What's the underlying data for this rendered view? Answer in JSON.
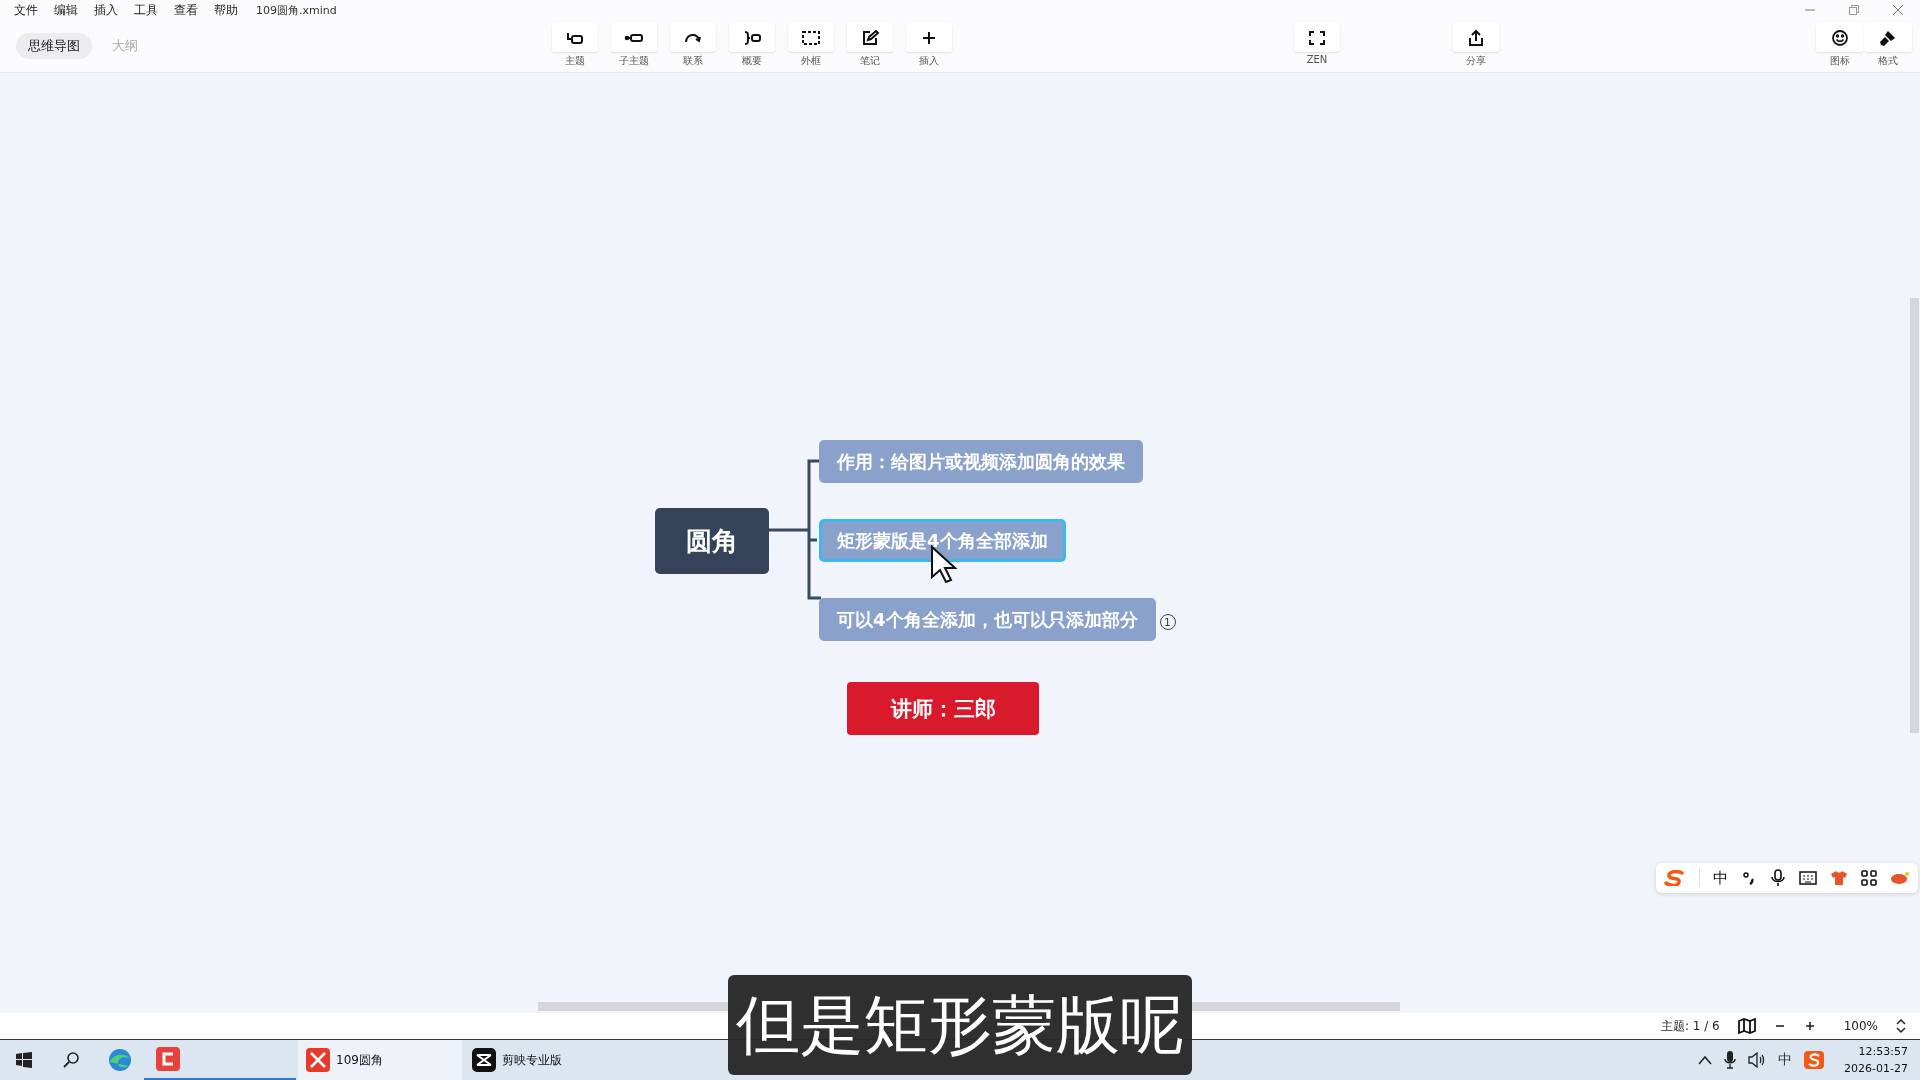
{
  "menu": [
    "文件",
    "编辑",
    "插入",
    "工具",
    "查看",
    "帮助"
  ],
  "file_name": "109圆角.xmind",
  "window_controls": [
    {
      "kind": "minimize"
    },
    {
      "kind": "restore"
    },
    {
      "kind": "close"
    }
  ],
  "view_tabs": [
    {
      "label": "思维导图",
      "selected": true
    },
    {
      "label": "大纲",
      "selected": false
    }
  ],
  "toolbar": [
    {
      "label": "主题",
      "kind": "topic"
    },
    {
      "label": "子主题",
      "kind": "subtopic"
    },
    {
      "label": "联系",
      "kind": "relation"
    },
    {
      "label": "概要",
      "kind": "summary"
    },
    {
      "label": "外框",
      "kind": "boundary"
    },
    {
      "label": "笔记",
      "kind": "note"
    },
    {
      "label": "插入",
      "kind": "insert"
    }
  ],
  "zen": {
    "label": "ZEN",
    "kind": "zen"
  },
  "share": {
    "label": "分享",
    "kind": "share"
  },
  "panel_tools": [
    {
      "label": "图标",
      "kind": "emoji"
    },
    {
      "label": "格式",
      "kind": "brush"
    }
  ],
  "mindmap": {
    "central": "圆角",
    "topics": [
      {
        "text": "作用：给图片或视频添加圆角的效果",
        "selected": false
      },
      {
        "text": "矩形蒙版是4个角全部添加",
        "selected": true
      },
      {
        "text": "可以4个角全添加，也可以只添加部分",
        "selected": false,
        "badge": "1"
      }
    ],
    "floating": "讲师：三郎"
  },
  "ime_bar": {
    "mode": "中"
  },
  "status_bar": {
    "topic_count": "主题: 1 / 6",
    "zoom": "100%"
  },
  "taskbar": {
    "apps": [
      {
        "label": "109圆角",
        "kind": "xmind"
      },
      {
        "label": "剪映专业版",
        "kind": "capcut"
      }
    ],
    "tray_ime": "中",
    "time": "12:53:57",
    "date": "2026-01-27"
  },
  "subtitle": "但是矩形蒙版呢"
}
